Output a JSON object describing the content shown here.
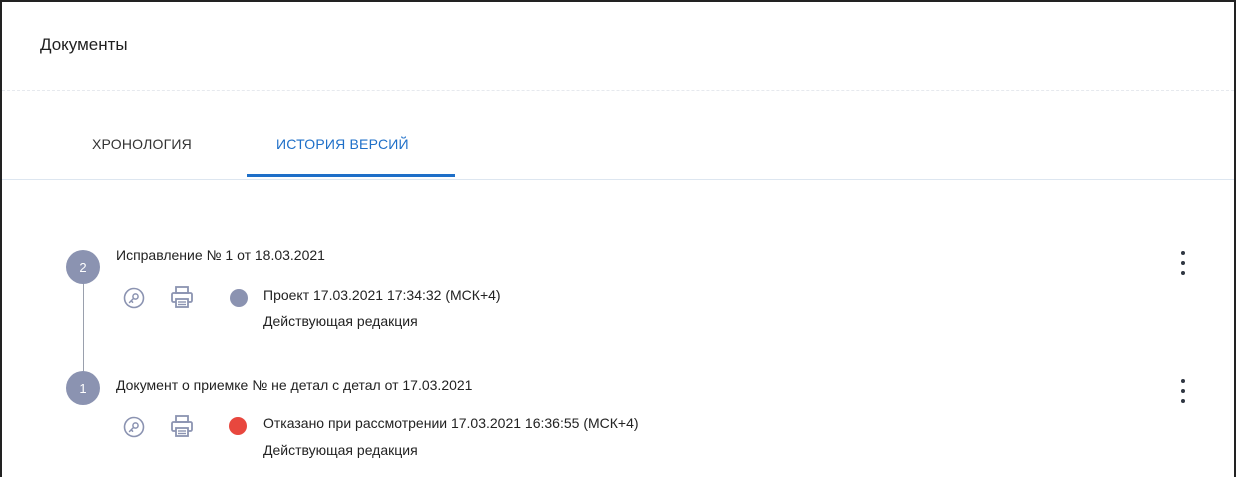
{
  "page": {
    "title": "Документы"
  },
  "tabs": [
    {
      "label": "ХРОНОЛОГИЯ",
      "active": false
    },
    {
      "label": "ИСТОРИЯ ВЕРСИЙ",
      "active": true
    }
  ],
  "versions": [
    {
      "step": "2",
      "title": "Исправление № 1 от 18.03.2021",
      "status_text": "Проект 17.03.2021 17:34:32 (МСК+4)",
      "status_color": "#8b93b1",
      "edition": "Действующая редакция",
      "icons": [
        "key-icon",
        "printer-icon",
        "kebab-menu-icon"
      ]
    },
    {
      "step": "1",
      "title": "Документ о приемке № не детал с детал от 17.03.2021",
      "status_text": "Отказано при рассмотрении 17.03.2021 16:36:55 (МСК+4)",
      "status_color": "#e8473e",
      "edition": "Действующая редакция",
      "icons": [
        "key-icon",
        "printer-icon",
        "kebab-menu-icon"
      ]
    }
  ],
  "colors": {
    "accent": "#1e6fc8",
    "step_badge": "#8b93b1",
    "timeline": "#9aa0ad",
    "icon": "#8b93b1"
  }
}
